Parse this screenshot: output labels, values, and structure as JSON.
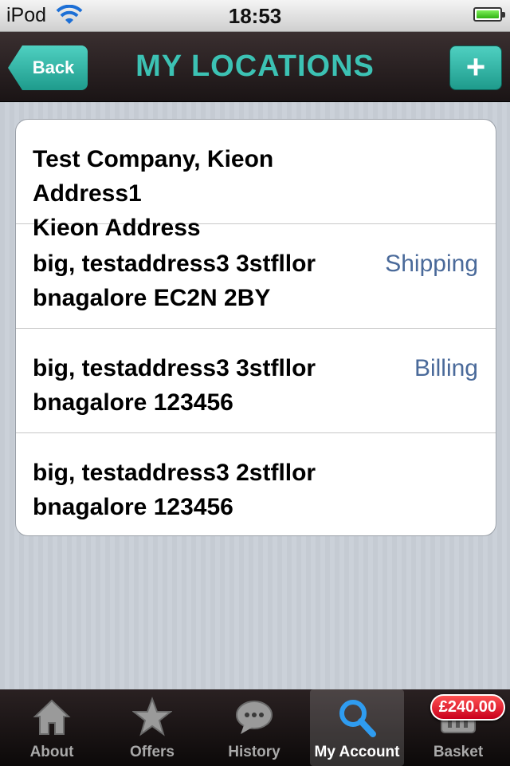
{
  "status": {
    "carrier": "iPod",
    "time": "18:53"
  },
  "nav": {
    "back_label": "Back",
    "title": "MY LOCATIONS",
    "add_label": "+"
  },
  "locations": [
    {
      "line1": "Test Company, Kieon Address1",
      "line2": "Kieon Address",
      "tag": ""
    },
    {
      "line1": "big, testaddress3 3stfllor",
      "line2": "bnagalore EC2N 2BY",
      "tag": "Shipping"
    },
    {
      "line1": "big, testaddress3 3stfllor",
      "line2": "bnagalore 123456",
      "tag": "Billing"
    },
    {
      "line1": "big, testaddress3 2stfllor",
      "line2": "bnagalore 123456",
      "tag": ""
    }
  ],
  "tabs": [
    {
      "label": "About",
      "icon": "house-icon"
    },
    {
      "label": "Offers",
      "icon": "star-icon"
    },
    {
      "label": "History",
      "icon": "speech-bubble-icon"
    },
    {
      "label": "My Account",
      "icon": "magnifier-icon"
    },
    {
      "label": "Basket",
      "icon": "basket-icon"
    }
  ],
  "basket_badge": "£240.00",
  "colors": {
    "accent": "#3cc2b4",
    "tag": "#4a6a9a",
    "badge": "#d8001f"
  }
}
